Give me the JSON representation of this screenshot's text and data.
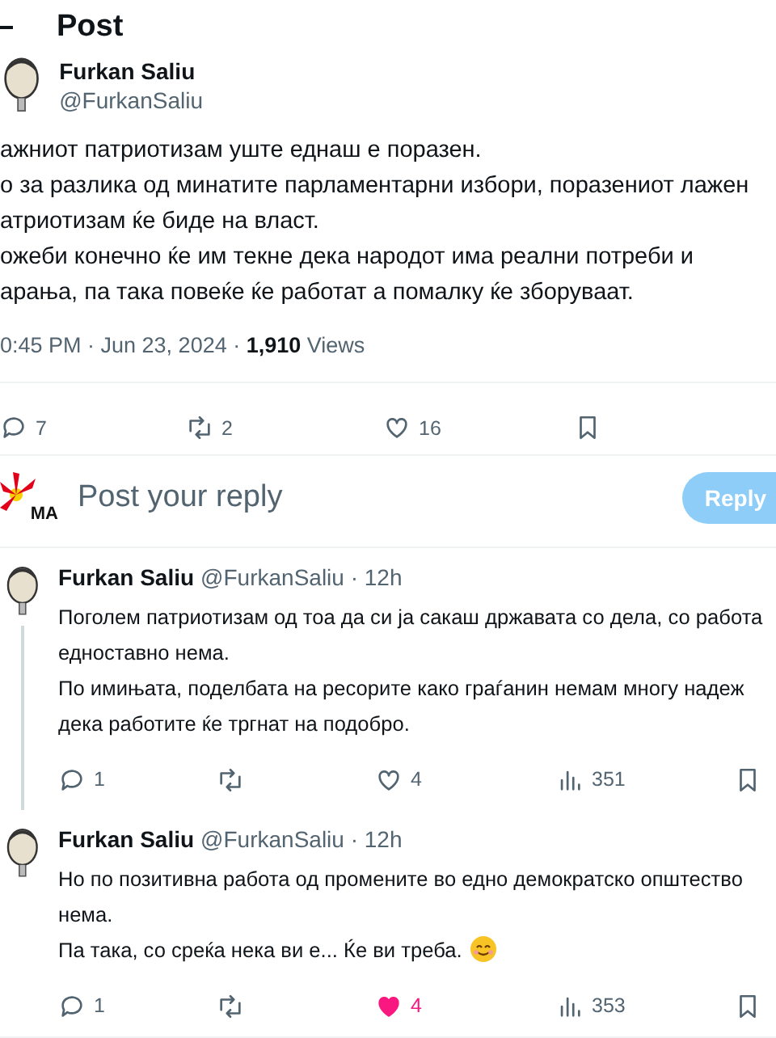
{
  "header": {
    "title": "Post"
  },
  "post": {
    "name": "Furkan Saliu",
    "handle": "@FurkanSaliu",
    "lines": [
      "ажниот патриотизам уште еднаш е поразен.",
      "о за разлика од минатите парламентарни избори, поразениот лажен",
      "атриотизам ќе биде на власт.",
      "ожеби конечно ќе им текне дека народот има реални потреби и",
      "арања, па така повеќе ќе работат а помалку ќе зборуваат."
    ],
    "time": "0:45 PM · Jun 23, 2024 · ",
    "views_count": "1,910",
    "views_label": " Views",
    "actions": {
      "replies": "7",
      "reposts": "2",
      "likes": "16"
    }
  },
  "composer": {
    "avatar_text": "MA",
    "placeholder": "Post your reply",
    "button": "Reply"
  },
  "replies": [
    {
      "name": "Furkan Saliu",
      "handle": "@FurkanSaliu · 12h",
      "lines": [
        "Поголем патриотизам од тоа да си ја сакаш државата со дела, со работа",
        "едноставно нема.",
        "По имињата, поделбата на ресорите како граѓанин немам многу надеж",
        "дека работите ќе тргнат на подобро."
      ],
      "emoji": false,
      "thread": true,
      "replies": "1",
      "likes": "4",
      "liked": false,
      "views": "351"
    },
    {
      "name": "Furkan Saliu",
      "handle": "@FurkanSaliu · 12h",
      "lines": [
        "Но по позитивна работа од промените во едно демократско општество",
        "нема.",
        "Па така, со среќа нека ви е... Ќе ви треба."
      ],
      "emoji": true,
      "thread": false,
      "replies": "1",
      "likes": "4",
      "liked": true,
      "views": "353"
    }
  ]
}
